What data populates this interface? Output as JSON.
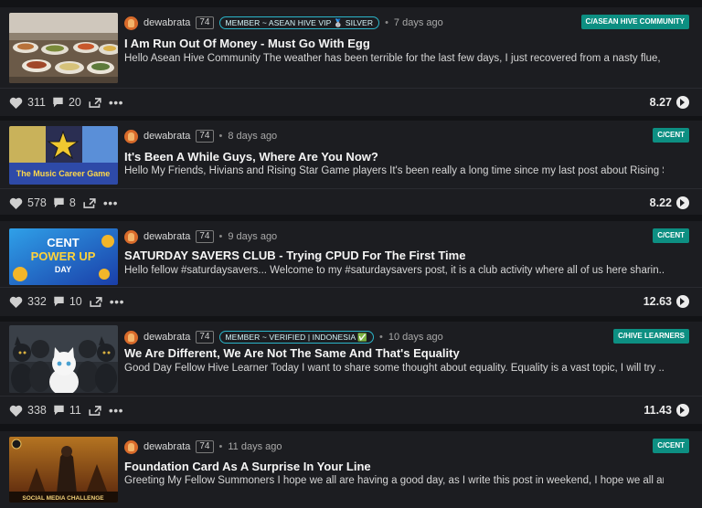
{
  "posts": [
    {
      "author": "dewabrata",
      "reputation": "74",
      "member_badge": "MEMBER ~ ASEAN HIVE VIP 🥈 SILVER",
      "time": "7 days ago",
      "community": "C/ASEAN HIVE COMMUNITY",
      "title": "I Am Run Out Of Money - Must Go With Egg",
      "summary": "Hello Asean Hive Community The weather has been terrible for the last few days, I just recovered from a nasty flue, b...",
      "votes": "311",
      "comments": "20",
      "payout": "8.27"
    },
    {
      "author": "dewabrata",
      "reputation": "74",
      "member_badge": "",
      "time": "8 days ago",
      "community": "C/CENT",
      "title": "It's Been A While Guys, Where Are You Now?",
      "summary": "Hello My Friends, Hivians and Rising Star Game players It's been really a long time since my last post about Rising S...",
      "votes": "578",
      "comments": "8",
      "payout": "8.22"
    },
    {
      "author": "dewabrata",
      "reputation": "74",
      "member_badge": "",
      "time": "9 days ago",
      "community": "C/CENT",
      "title": "SATURDAY SAVERS CLUB - Trying CPUD For The First Time",
      "summary": "Hello fellow #saturdaysavers... Welcome to my #saturdaysavers post, it is a club activity where all of us here sharin...",
      "votes": "332",
      "comments": "10",
      "payout": "12.63"
    },
    {
      "author": "dewabrata",
      "reputation": "74",
      "member_badge": "MEMBER ~ VERIFIED | INDONESIA ✅",
      "time": "10 days ago",
      "community": "C/HIVE LEARNERS",
      "title": "We Are Different, We Are Not The Same And That's Equality",
      "summary": "Good Day Fellow Hive Learner Today I want to share some thought about equality. Equality is a vast topic, I will try ...",
      "votes": "338",
      "comments": "11",
      "payout": "11.43"
    },
    {
      "author": "dewabrata",
      "reputation": "74",
      "member_badge": "",
      "time": "11 days ago",
      "community": "C/CENT",
      "title": "Foundation Card As A Surprise In Your Line",
      "summary": "Greeting My Fellow Summoners I hope we all are having a good day, as I write this post in weekend, I hope we all are ...",
      "votes": "",
      "comments": "",
      "payout": ""
    }
  ],
  "thumbnails": {
    "post2_caption": "The Music Career Game",
    "post3_line1": "CENT",
    "post3_line2": "POWER UP",
    "post3_line3": "DAY",
    "post5_caption": "SOCIAL MEDIA CHALLENGE"
  },
  "colors": {
    "community_badge": "#0d8f82",
    "member_badge_border": "#2bb5c9",
    "card_background": "#1c1d21",
    "page_background": "#121316"
  },
  "icons": [
    "heart-icon",
    "comment-icon",
    "reblog-icon",
    "more-icon",
    "hive-icon"
  ]
}
